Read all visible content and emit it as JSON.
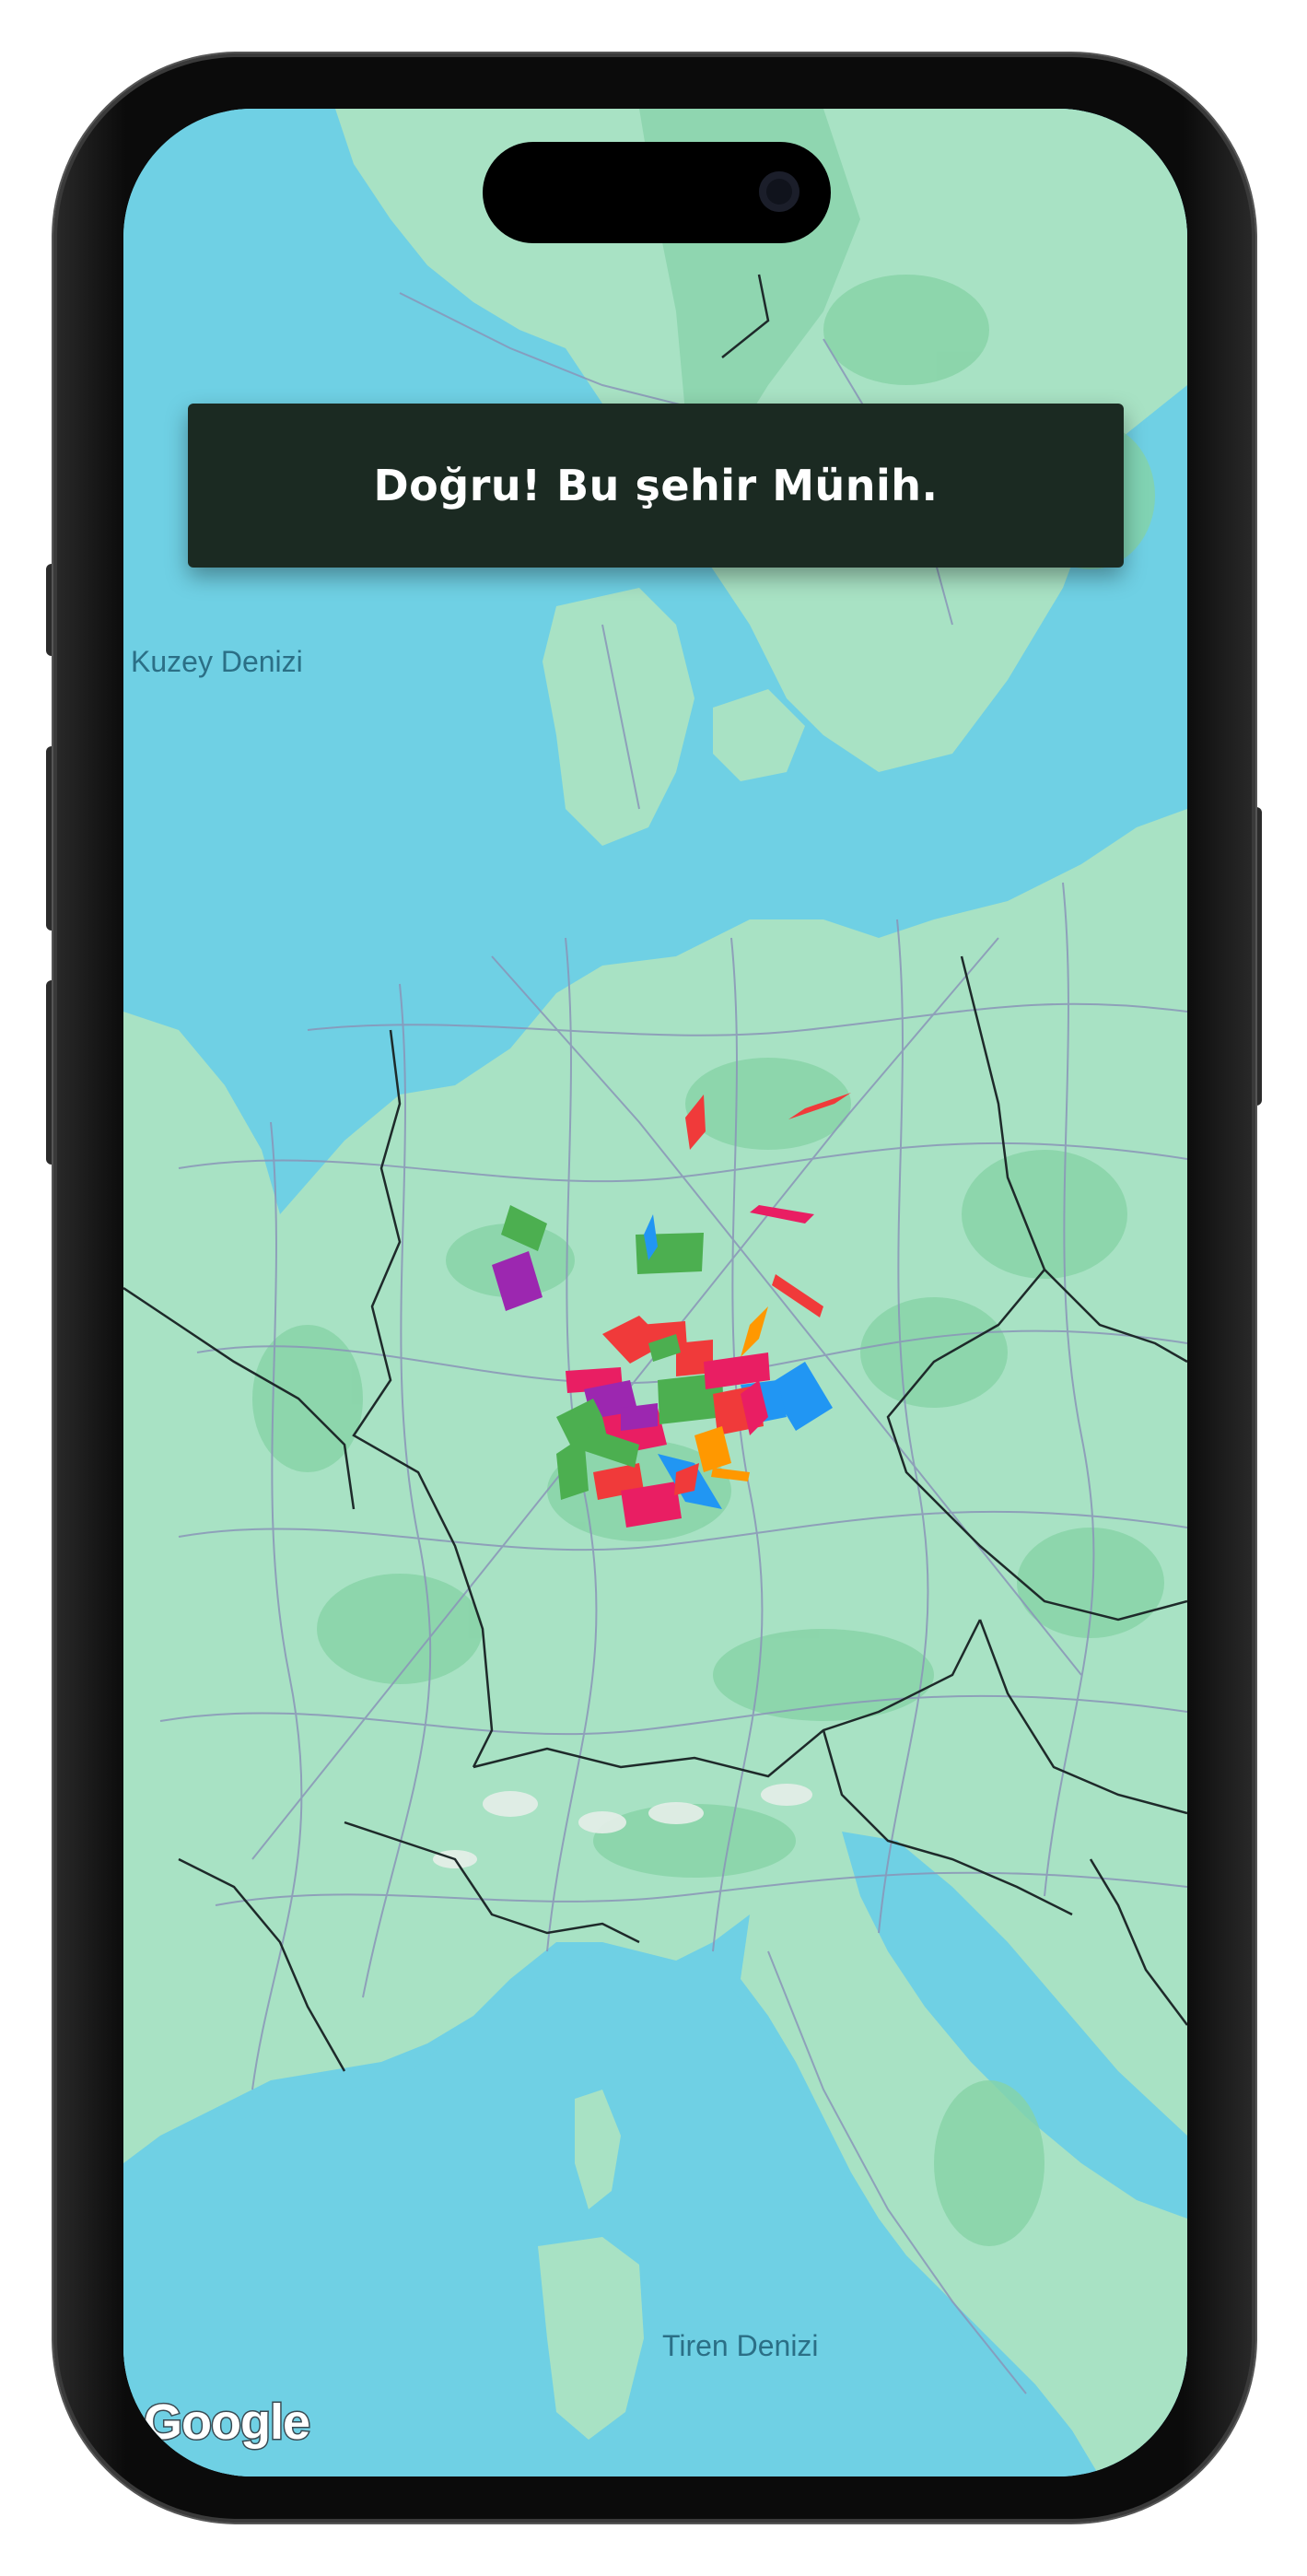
{
  "toast": {
    "message": "Doğru! Bu şehir Münih."
  },
  "map": {
    "labels": {
      "north_sea": "Kuzey Denizi",
      "tyrrhenian_sea": "Tiren Denizi"
    },
    "attribution": "Google",
    "colors": {
      "water": "#6fd0e4",
      "land": "#a8e2c4",
      "forest": "#86d3a6",
      "roads": "#8a95b8",
      "borders": "#1e2a2a"
    }
  },
  "confetti_colors": [
    "#f03a3a",
    "#e91e63",
    "#4caf50",
    "#2196f3",
    "#9c27b0",
    "#ff9800"
  ]
}
